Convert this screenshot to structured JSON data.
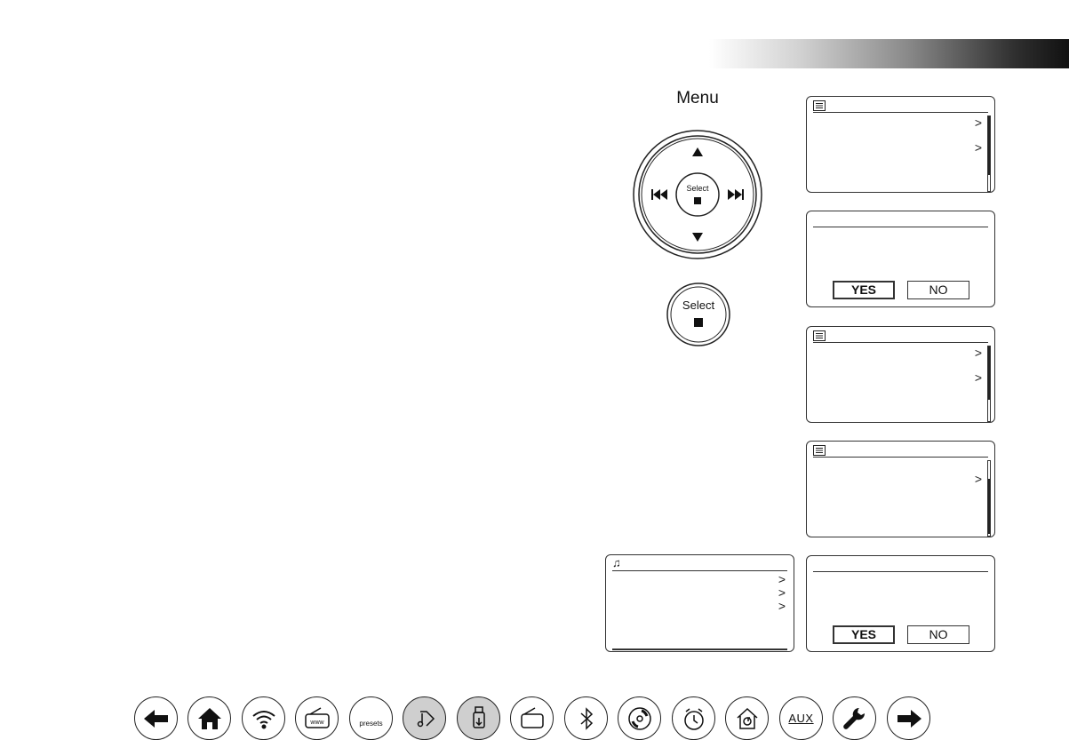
{
  "header": {
    "title": ""
  },
  "controller": {
    "menu_label": "Menu",
    "select_label": "Select"
  },
  "select_button": {
    "label": "Select"
  },
  "screens": {
    "dialog_1": {
      "yes_label": "YES",
      "no_label": "NO"
    },
    "dialog_2": {
      "yes_label": "YES",
      "no_label": "NO"
    },
    "chevron": ">"
  },
  "icons": {
    "menu": "menu-list-icon",
    "music": "music-note-icon"
  },
  "nav_bar": {
    "items": [
      {
        "name": "back-arrow",
        "label": ""
      },
      {
        "name": "home",
        "label": ""
      },
      {
        "name": "wifi",
        "label": ""
      },
      {
        "name": "internet-radio",
        "label": ""
      },
      {
        "name": "presets",
        "label": "presets"
      },
      {
        "name": "music-player",
        "label": ""
      },
      {
        "name": "usb",
        "label": ""
      },
      {
        "name": "radio",
        "label": ""
      },
      {
        "name": "bluetooth",
        "label": ""
      },
      {
        "name": "cd",
        "label": ""
      },
      {
        "name": "alarm",
        "label": ""
      },
      {
        "name": "home-media",
        "label": ""
      },
      {
        "name": "aux",
        "label": "AUX"
      },
      {
        "name": "settings",
        "label": ""
      },
      {
        "name": "forward-arrow",
        "label": ""
      }
    ],
    "shaded": [
      "music-player",
      "usb"
    ]
  }
}
